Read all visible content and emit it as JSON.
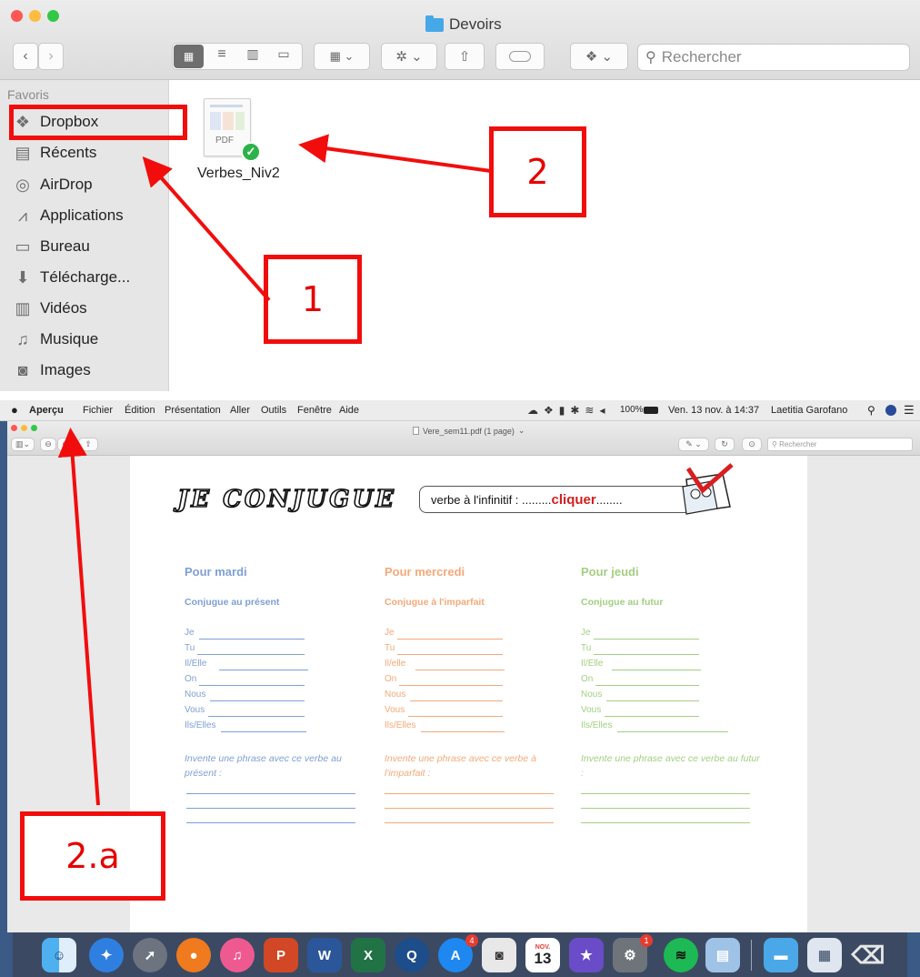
{
  "finder": {
    "title": "Devoirs",
    "search_placeholder": "Rechercher",
    "sidebar_heading": "Favoris",
    "sidebar_items": [
      {
        "label": "Dropbox",
        "icon": "dropbox-icon"
      },
      {
        "label": "Récents",
        "icon": "recents-icon"
      },
      {
        "label": "AirDrop",
        "icon": "airdrop-icon"
      },
      {
        "label": "Applications",
        "icon": "applications-icon"
      },
      {
        "label": "Bureau",
        "icon": "desktop-icon"
      },
      {
        "label": "Télécharge...",
        "icon": "downloads-icon"
      },
      {
        "label": "Vidéos",
        "icon": "videos-icon"
      },
      {
        "label": "Musique",
        "icon": "music-icon"
      },
      {
        "label": "Images",
        "icon": "images-icon"
      }
    ],
    "file": {
      "name": "Verbes_Niv2",
      "type_label": "PDF"
    }
  },
  "annotations": {
    "step1": "1",
    "step2": "2",
    "step2a": "2.a",
    "color": "#f20d0d"
  },
  "preview": {
    "menubar": {
      "app": "Aperçu",
      "menus": [
        "Fichier",
        "Édition",
        "Présentation",
        "Aller",
        "Outils",
        "Fenêtre",
        "Aide"
      ],
      "battery": "100%",
      "datetime": "Ven. 13 nov. à 14:37",
      "user": "Laetitia Garofano"
    },
    "window_title": "Vere_sem11.pdf (1 page)",
    "search_placeholder": "Rechercher",
    "document": {
      "title": "JE CONJUGUE",
      "infinitive_prefix": "verbe à l'infinitif : .........",
      "infinitive_word": "cliquer",
      "infinitive_suffix": "........",
      "columns": [
        {
          "day": "Pour mardi",
          "task": "Conjugue au présent",
          "color": "#7f9fd4",
          "pronouns": [
            "Je",
            "Tu",
            "Il/Elle",
            "On",
            "Nous",
            "Vous",
            "Ils/Elles"
          ],
          "phrase": "Invente une phrase avec ce verbe au présent :"
        },
        {
          "day": "Pour mercredi",
          "task": "Conjugue à l'imparfait",
          "color": "#f4a97a",
          "pronouns": [
            "Je",
            "Tu",
            "Il/elle",
            "On",
            "Nous",
            "Vous",
            "Ils/Elles"
          ],
          "phrase": "Invente une phrase avec ce verbe à l'imparfait :"
        },
        {
          "day": "Pour jeudi",
          "task": "Conjugue au futur",
          "color": "#a4cf82",
          "pronouns": [
            "Je",
            "Tu",
            "Il/Elle",
            "On",
            "Nous",
            "Vous",
            "Ils/Elles"
          ],
          "phrase": "Invente une phrase avec ce verbe au futur :"
        }
      ]
    },
    "dock": {
      "calendar_month": "NOV.",
      "calendar_day": "13",
      "badge_appstore": "4",
      "badge_prefs": "1"
    }
  }
}
